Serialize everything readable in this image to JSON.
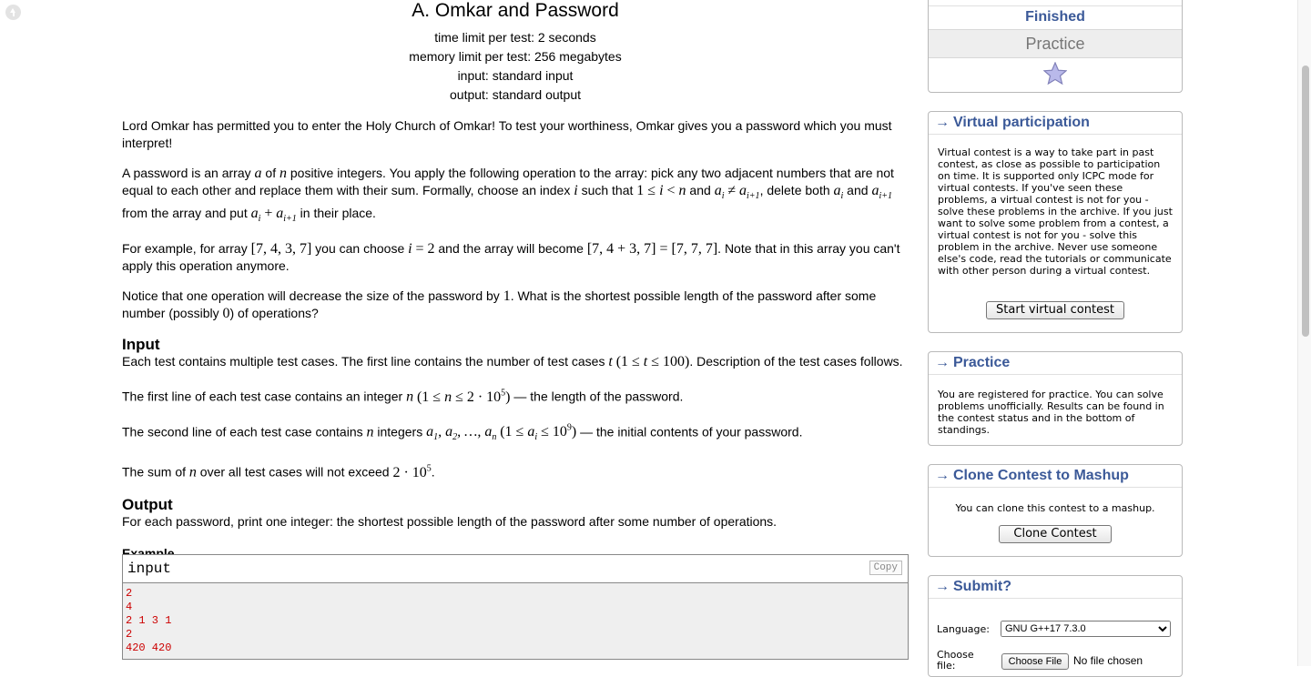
{
  "problem": {
    "title": "A. Omkar and Password",
    "time_limit": "time limit per test: 2 seconds",
    "memory_limit": "memory limit per test: 256 megabytes",
    "input": "input: standard input",
    "output": "output: standard output",
    "input_title": "Input",
    "output_title": "Output",
    "example_title": "Example",
    "output_text": "For each password, print one integer: the shortest possible length of the password after some number of operations."
  },
  "sample": {
    "label": "input",
    "copy": "Copy",
    "lines": [
      "2",
      "4",
      "2 1 3 1",
      "2",
      "420 420"
    ]
  },
  "sidebar": {
    "status": "Finished",
    "mode": "Practice",
    "virtual": {
      "title": "Virtual participation",
      "text": "Virtual contest is a way to take part in past contest, as close as possible to participation on time. It is supported only ICPC mode for virtual contests. If you've seen these problems, a virtual contest is not for you - solve these problems in the archive. If you just want to solve some problem from a contest, a virtual contest is not for you - solve this problem in the archive. Never use someone else's code, read the tutorials or communicate with other person during a virtual contest.",
      "button": "Start virtual contest"
    },
    "practice": {
      "title": "Practice",
      "text": "You are registered for practice. You can solve problems unofficially. Results can be found in the contest status and in the bottom of standings."
    },
    "clone": {
      "title": "Clone Contest to Mashup",
      "text": "You can clone this contest to a mashup.",
      "button": "Clone Contest"
    },
    "submit": {
      "title": "Submit?",
      "language_label": "Language:",
      "language_value": "GNU G++17 7.3.0",
      "choose_label": "Choose file:",
      "choose_button": "Choose File",
      "no_file": "No file chosen"
    },
    "arrow": "→"
  },
  "colors": {
    "link": "#3b5998",
    "sample_text": "#cc0000"
  }
}
